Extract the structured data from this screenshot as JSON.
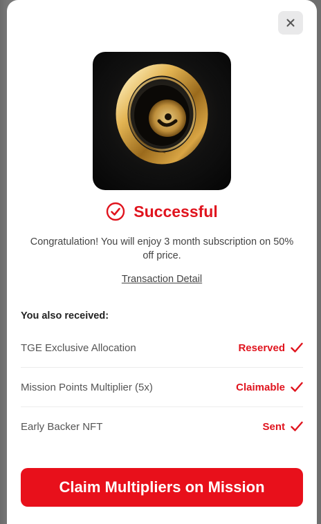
{
  "modal": {
    "close_label": "✕",
    "status": "Successful",
    "message": "Congratulation! You will enjoy 3 month subscription on 50% off price.",
    "transaction_link": "Transaction Detail",
    "received_heading": "You also received:",
    "received": [
      {
        "label": "TGE Exclusive Allocation",
        "status": "Reserved"
      },
      {
        "label": "Mission Points Multiplier (5x)",
        "status": "Claimable"
      },
      {
        "label": "Early Backer NFT",
        "status": "Sent"
      }
    ],
    "cta_label": "Claim Multipliers on Mission"
  },
  "colors": {
    "accent": "#e8101b",
    "text": "#444444",
    "close_bg": "#e9e9ea"
  },
  "icons": {
    "close": "close-icon",
    "status": "check-circle-icon",
    "row_check": "checkmark-icon",
    "hero": "gold-ring-image"
  }
}
